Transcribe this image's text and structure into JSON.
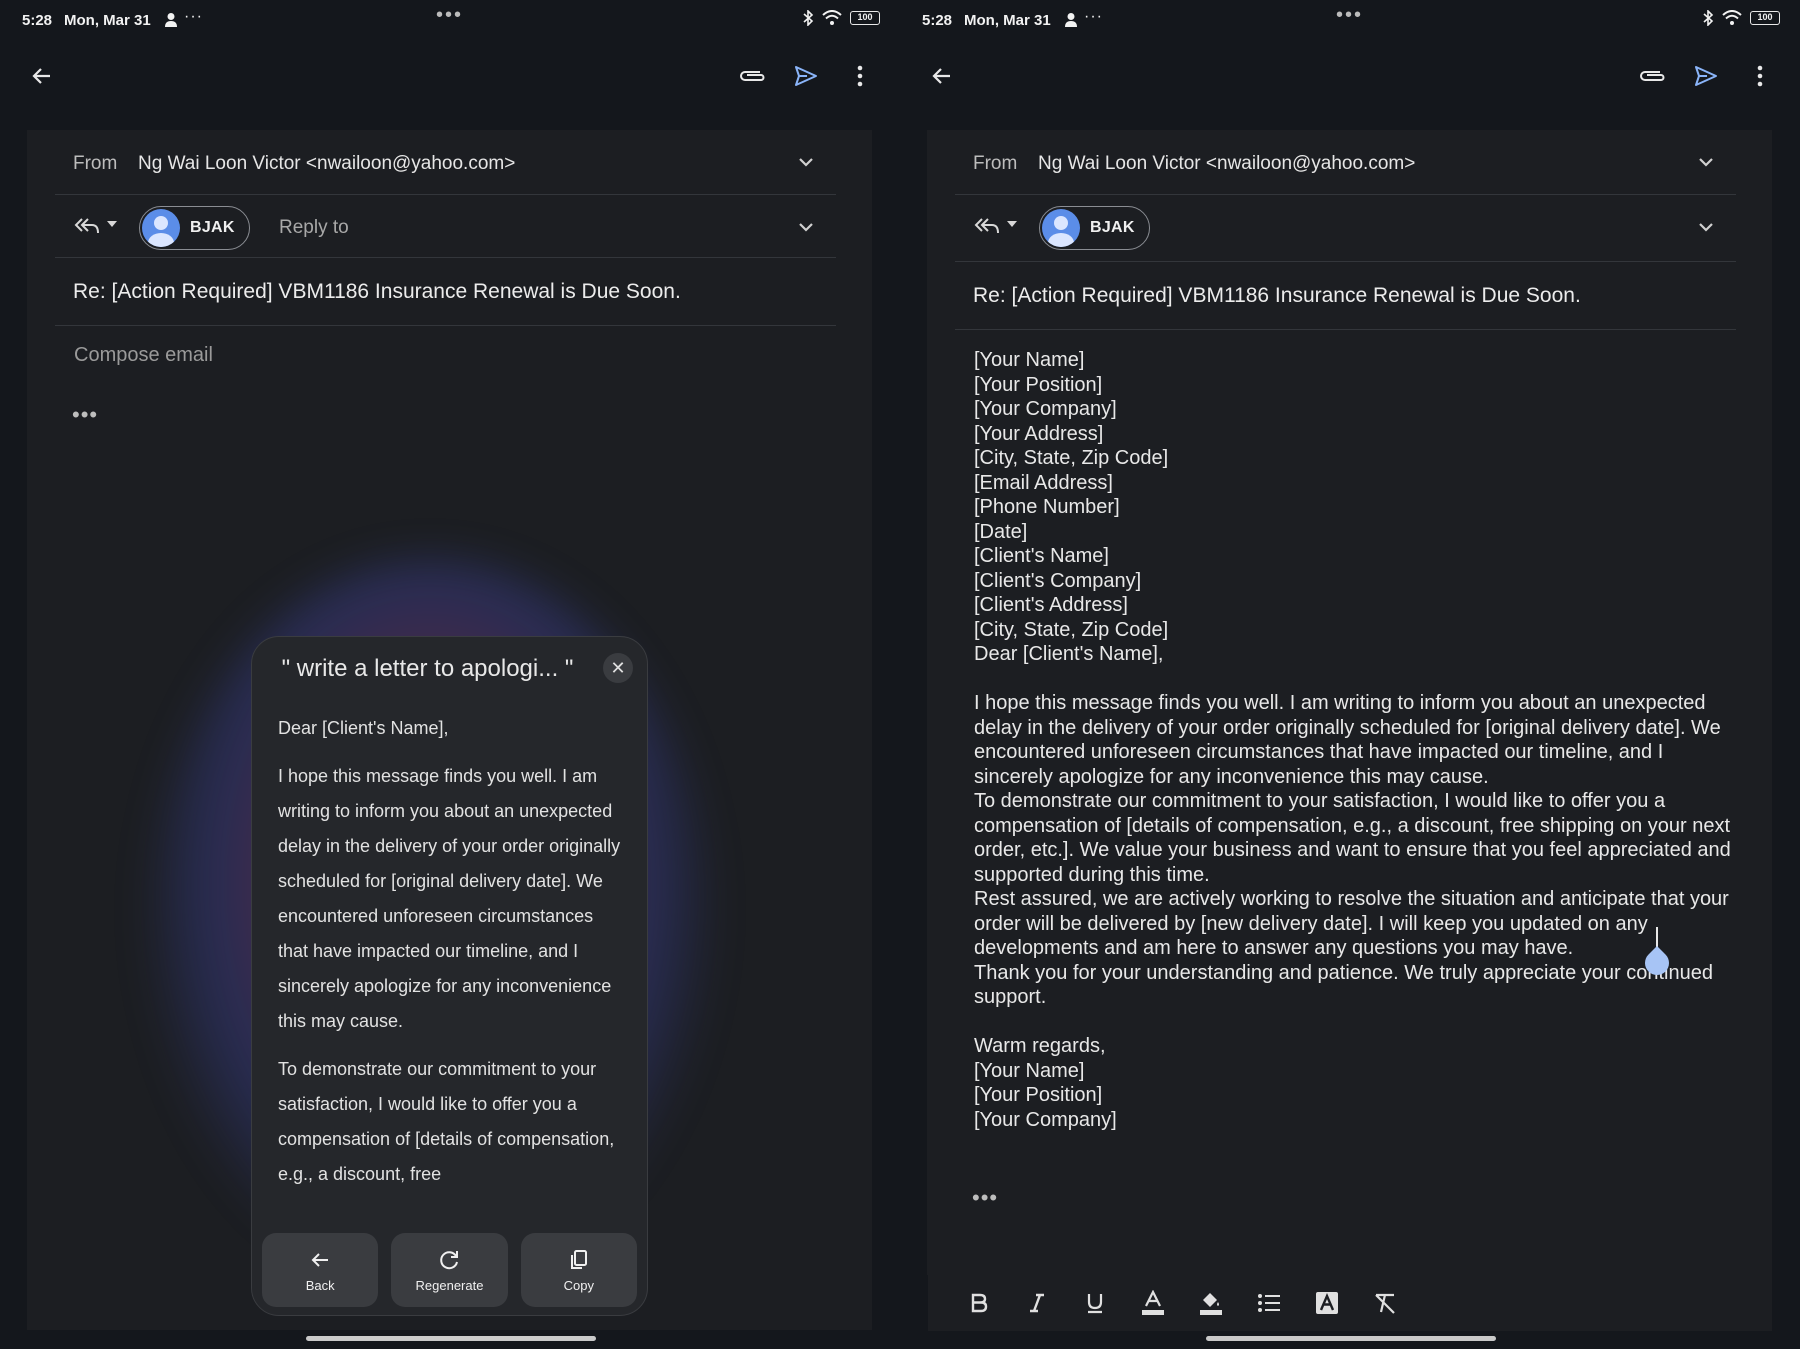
{
  "status": {
    "time": "5:28",
    "date": "Mon, Mar 31",
    "more": "···",
    "battery": "100"
  },
  "compose": {
    "from_label": "From",
    "from_value": "Ng Wai Loon Victor <nwailoon@yahoo.com>",
    "to_chip": "BJAK",
    "reply_to_placeholder": "Reply to",
    "subject": "Re: [Action Required] VBM1186 Insurance Renewal is Due Soon.",
    "body_placeholder": "Compose email",
    "ellipsis": "•••"
  },
  "ai_panel": {
    "title": "\" write a letter to apologi... \"",
    "close": "✕",
    "paragraphs": [
      "Dear [Client's Name],",
      "I hope this message finds you well. I am writing to inform you about an unexpected delay in the delivery of your order originally scheduled for [original delivery date]. We encountered unforeseen circumstances that have impacted our timeline, and I sincerely apologize for any inconvenience this may cause.",
      "To demonstrate our commitment to your satisfaction, I would like to offer you a compensation of [details of compensation, e.g., a discount, free"
    ],
    "actions": [
      {
        "label": "Back",
        "icon": "arrow-left-icon"
      },
      {
        "label": "Regenerate",
        "icon": "refresh-icon"
      },
      {
        "label": "Copy",
        "icon": "copy-icon"
      }
    ]
  },
  "letter_body": "[Your Name]\n[Your Position]\n[Your Company]\n[Your Address]\n[City, State, Zip Code]\n[Email Address]\n[Phone Number]\n[Date]\n[Client's Name]\n[Client's Company]\n[Client's Address]\n[City, State, Zip Code]\nDear [Client's Name],\n\nI hope this message finds you well. I am writing to inform you about an unexpected delay in the delivery of your order originally scheduled for [original delivery date]. We encountered unforeseen circumstances that have impacted our timeline, and I sincerely apologize for any inconvenience this may cause.\nTo demonstrate our commitment to your satisfaction, I would like to offer you a compensation of [details of compensation, e.g., a discount, free shipping on your next order, etc.]. We value your business and want to ensure that you feel appreciated and supported during this time.\nRest assured, we are actively working to resolve the situation and anticipate that your order will be delivered by [new delivery date]. I will keep you updated on any developments and am here to answer any questions you may have.\nThank you for your understanding and patience. We truly appreciate your continued support.\n\nWarm regards,\n[Your Name]\n[Your Position]\n[Your Company]",
  "format_toolbar": [
    "bold-icon",
    "italic-icon",
    "underline-icon",
    "text-color-icon",
    "highlight-icon",
    "bulleted-list-icon",
    "text-style-icon",
    "clear-formatting-icon"
  ],
  "colors": {
    "background": "#14171c",
    "card": "#1c1e22",
    "send_accent": "#8ab4f8"
  }
}
